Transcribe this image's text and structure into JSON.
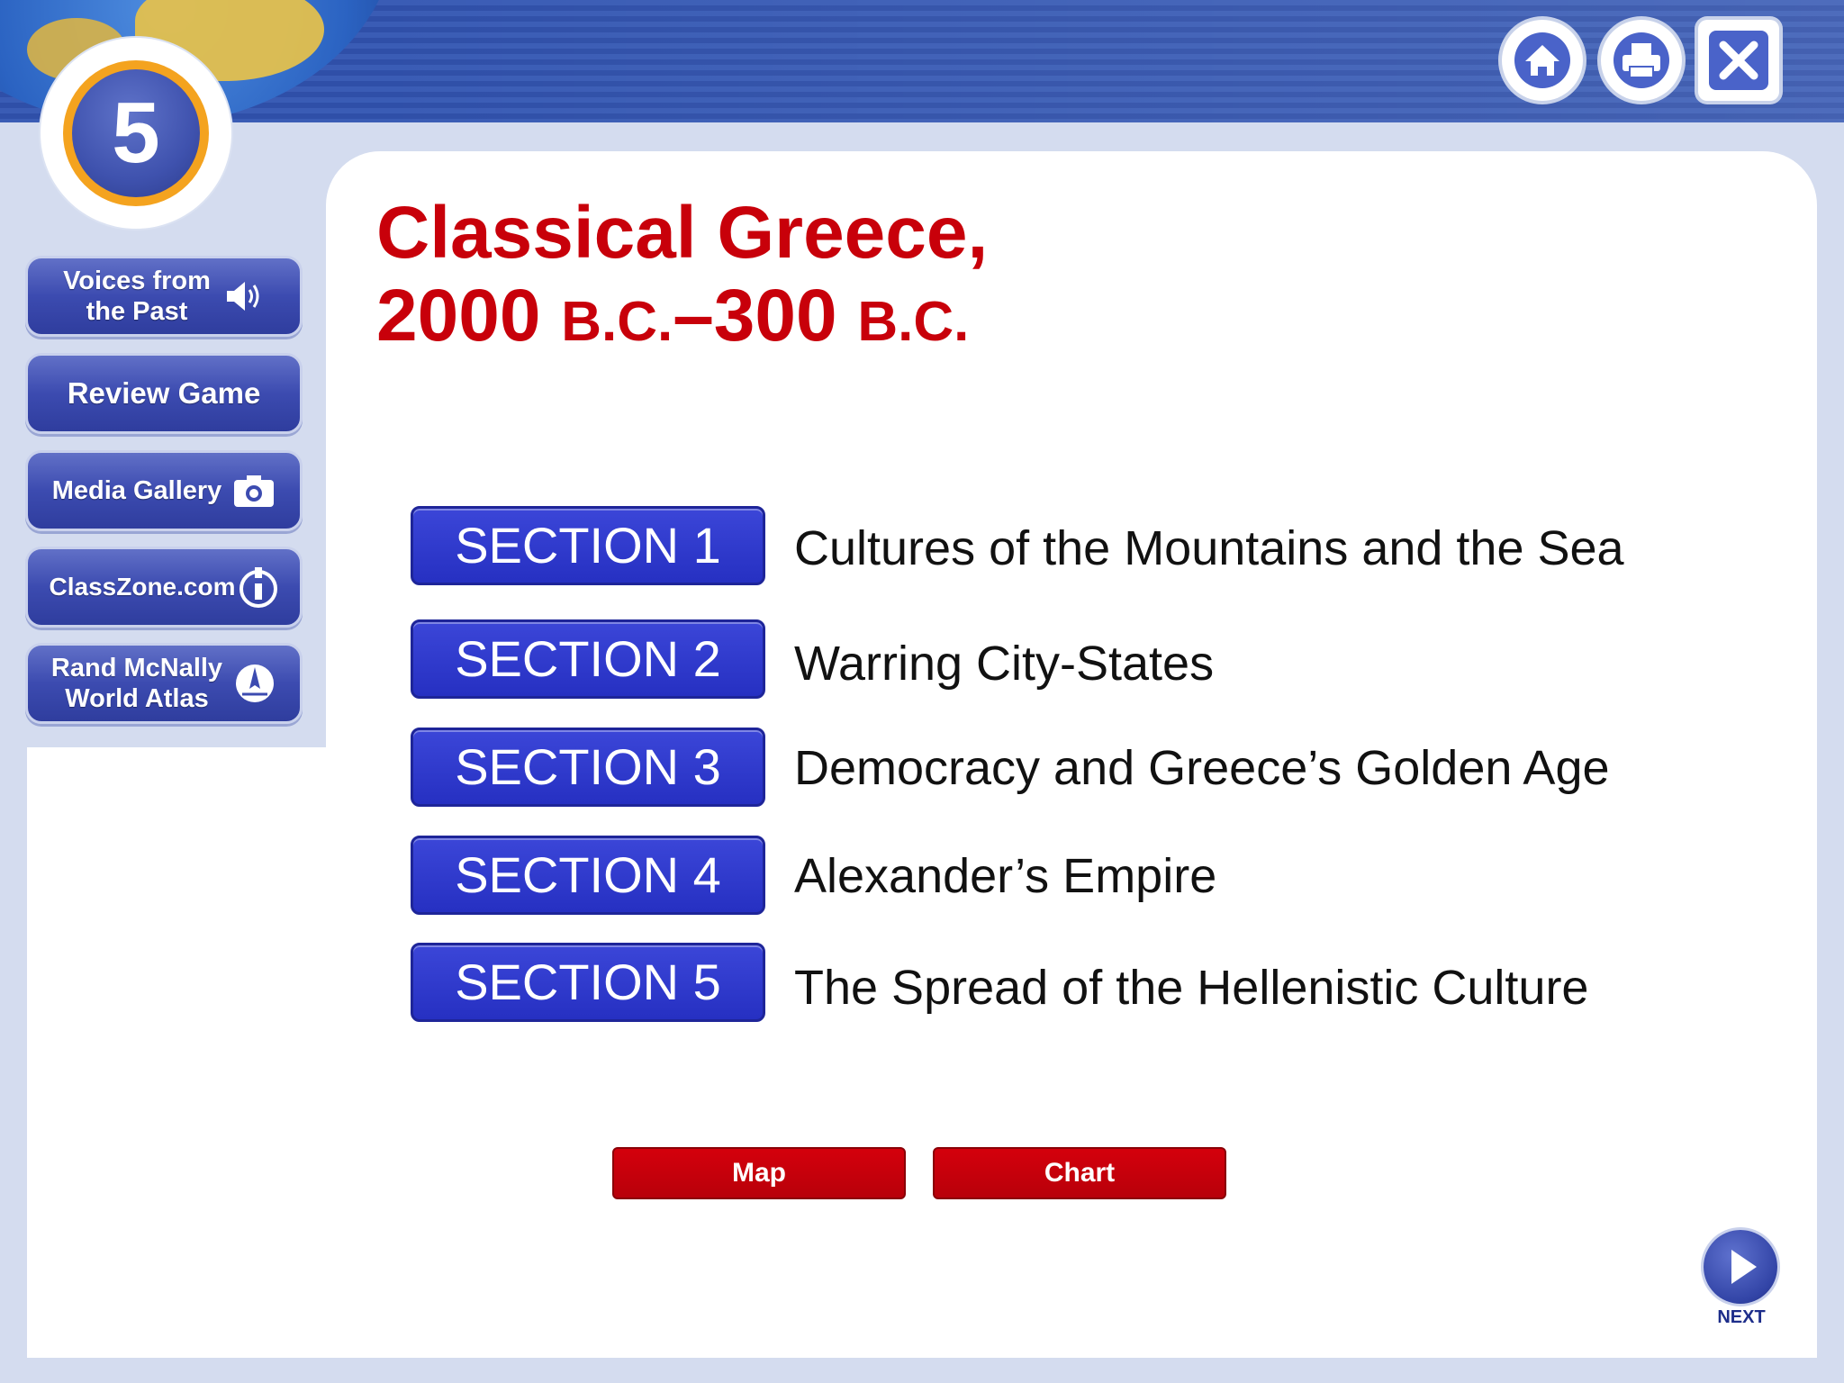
{
  "header": {
    "chapter_number": "5",
    "toolbar": {
      "home_icon": "home-icon",
      "print_icon": "print-icon",
      "close_icon": "close-icon"
    }
  },
  "sidebar": {
    "items": [
      {
        "label_line1": "Voices from",
        "label_line2": "the Past",
        "icon": "speaker-icon"
      },
      {
        "label": "Review Game"
      },
      {
        "label": "Media Gallery",
        "icon": "camera-icon"
      },
      {
        "label": "ClassZone.com",
        "icon": "info-globe-icon"
      },
      {
        "label_line1": "Rand McNally",
        "label_line2": "World Atlas",
        "icon": "compass-icon"
      }
    ]
  },
  "main": {
    "title_line1": "Classical Greece,",
    "title_line2_a": "2000 ",
    "title_line2_b": "B.C.",
    "title_line2_c": "–300 ",
    "title_line2_d": "B.C.",
    "sections": [
      {
        "button": "SECTION 1",
        "title": "Cultures of the Mountains and the Sea"
      },
      {
        "button": "SECTION 2",
        "title": "Warring City-States"
      },
      {
        "button": "SECTION 3",
        "title": "Democracy and Greece’s Golden Age"
      },
      {
        "button": "SECTION 4",
        "title": "Alexander’s Empire"
      },
      {
        "button": "SECTION 5",
        "title": "The Spread of the Hellenistic Culture"
      }
    ],
    "map_button": "Map",
    "chart_button": "Chart"
  },
  "footer": {
    "next_label": "NEXT"
  },
  "colors": {
    "title_red": "#c8000a",
    "section_blue": "#2630c2",
    "nav_blue": "#3c4bb0",
    "button_red": "#c4000b"
  }
}
